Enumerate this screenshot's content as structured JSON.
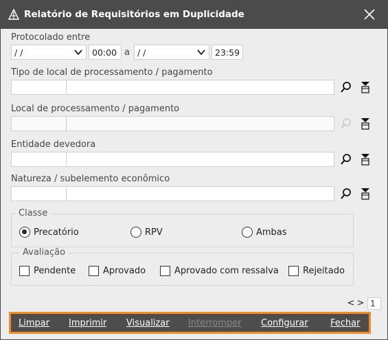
{
  "window": {
    "title": "Relatório de Requisitórios em Duplicidade"
  },
  "protocolado": {
    "label": "Protocolado entre",
    "date_from": "/ /",
    "time_from": "00:00",
    "separator": "a",
    "date_to": "/ /",
    "time_to": "23:59"
  },
  "tipo_local": {
    "label": "Tipo de local de processamento / pagamento",
    "code": "",
    "description": ""
  },
  "local": {
    "label": "Local de processamento / pagamento",
    "code": "",
    "description": ""
  },
  "entidade": {
    "label": "Entidade devedora",
    "code": "",
    "description": ""
  },
  "natureza": {
    "label": "Natureza / subelemento econômico",
    "code": "",
    "description": ""
  },
  "classe": {
    "legend": "Classe",
    "options": [
      "Precatório",
      "RPV",
      "Ambas"
    ],
    "selected": "Precatório"
  },
  "avaliacao": {
    "legend": "Avaliação",
    "options": [
      "Pendente",
      "Aprovado",
      "Aprovado com ressalva",
      "Rejeitado"
    ]
  },
  "pager": {
    "prev": "<",
    "next": ">",
    "page": "1"
  },
  "footer": {
    "limpar": "Limpar",
    "imprimir": "Imprimir",
    "visualizar": "Visualizar",
    "interromper": "Interromper",
    "configurar": "Configurar",
    "fechar": "Fechar"
  },
  "colors": {
    "titlebar": "#4b4b4b",
    "footer": "#4d4d4d",
    "footer_border": "#f28c28"
  },
  "icons": [
    "app-icon",
    "close-icon",
    "chevron-down-icon",
    "search-icon",
    "filter-icon"
  ]
}
